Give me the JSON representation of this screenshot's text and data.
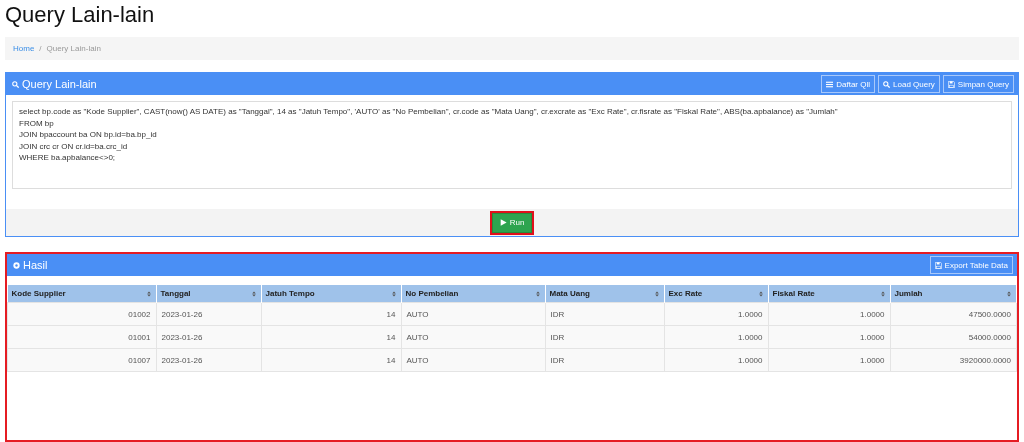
{
  "page_title": "Query Lain-lain",
  "breadcrumb": {
    "separator": "/",
    "items": [
      {
        "label": "Home",
        "kind": "link"
      },
      {
        "label": "Query Lain-lain",
        "kind": "current"
      }
    ]
  },
  "query_panel": {
    "title": "Query Lain-lain",
    "buttons": [
      "Daftar Qll",
      "Load Query",
      "Simpan Query"
    ],
    "query": "select bp.code as \"Kode Supplier\", CAST(now() AS DATE) as \"Tanggal\", 14 as \"Jatuh Tempo\", 'AUTO' as \"No Pembelian\", cr.code as \"Mata Uang\", cr.excrate as \"Exc Rate\", cr.fisrate as \"Fiskal Rate\", ABS(ba.apbalance) as \"Jumlah\"\nFROM bp\nJOIN bpaccount ba ON bp.id=ba.bp_id\nJOIN crc cr ON cr.id=ba.crc_id\nWHERE ba.apbalance<>0;",
    "run_button": {
      "label": "Run",
      "highlighted": true
    }
  },
  "result_panel": {
    "title": "Hasil",
    "highlighted": true,
    "export_button": "Export Table Data",
    "table": {
      "columns": [
        {
          "label": "Kode Supplier",
          "kind": "number"
        },
        {
          "label": "Tanggal",
          "kind": "text"
        },
        {
          "label": "Jatuh Tempo",
          "kind": "number"
        },
        {
          "label": "No Pembelian",
          "kind": "text"
        },
        {
          "label": "Mata Uang",
          "kind": "text"
        },
        {
          "label": "Exc Rate",
          "kind": "number"
        },
        {
          "label": "Fiskal Rate",
          "kind": "number"
        },
        {
          "label": "Jumlah",
          "kind": "number"
        }
      ],
      "rows": [
        [
          "01002",
          "2023-01-26",
          "14",
          "AUTO",
          "IDR",
          "1.0000",
          "1.0000",
          "47500.0000"
        ],
        [
          "01001",
          "2023-01-26",
          "14",
          "AUTO",
          "IDR",
          "1.0000",
          "1.0000",
          "54000.0000"
        ],
        [
          "01007",
          "2023-01-26",
          "14",
          "AUTO",
          "IDR",
          "1.0000",
          "1.0000",
          "3920000.0000"
        ]
      ]
    }
  }
}
